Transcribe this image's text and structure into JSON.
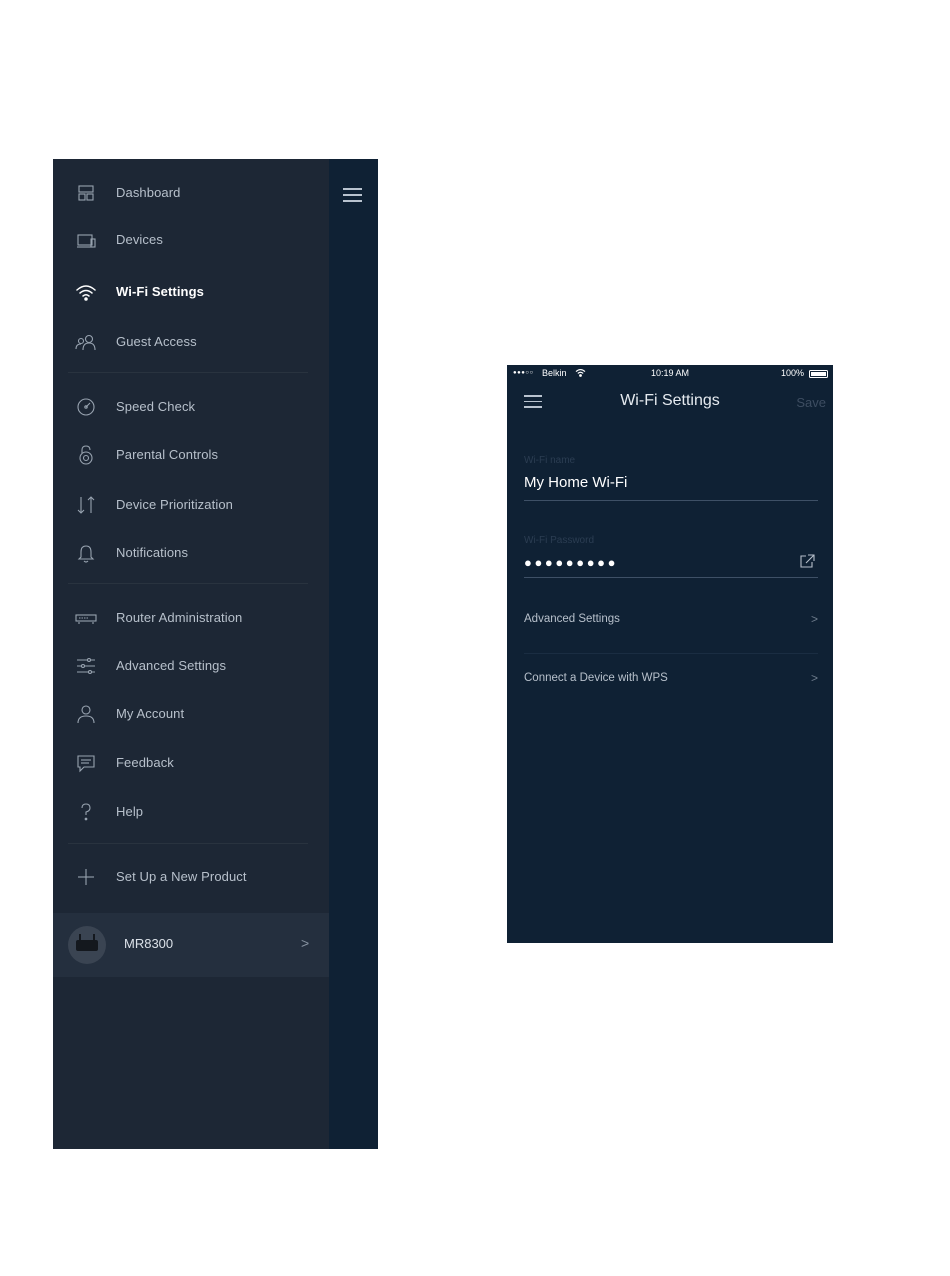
{
  "side_menu": {
    "items": [
      {
        "label": "Dashboard",
        "icon": "dashboard-icon",
        "active": false
      },
      {
        "label": "Devices",
        "icon": "devices-icon",
        "active": false
      },
      {
        "label": "Wi-Fi Settings",
        "icon": "wifi-icon",
        "active": true
      },
      {
        "label": "Guest Access",
        "icon": "guest-access-icon",
        "active": false
      },
      {
        "label": "Speed Check",
        "icon": "speedometer-icon",
        "active": false
      },
      {
        "label": "Parental Controls",
        "icon": "padlock-icon",
        "active": false
      },
      {
        "label": "Device Prioritization",
        "icon": "arrows-up-down-icon",
        "active": false
      },
      {
        "label": "Notifications",
        "icon": "bell-icon",
        "active": false
      },
      {
        "label": "Router Administration",
        "icon": "router-icon",
        "active": false
      },
      {
        "label": "Advanced Settings",
        "icon": "sliders-icon",
        "active": false
      },
      {
        "label": "My Account",
        "icon": "user-icon",
        "active": false
      },
      {
        "label": "Feedback",
        "icon": "chat-bubble-icon",
        "active": false
      },
      {
        "label": "Help",
        "icon": "question-icon",
        "active": false
      },
      {
        "label": "Set Up a New Product",
        "icon": "plus-icon",
        "active": false
      }
    ],
    "device": {
      "name": "MR8300",
      "chevron": ">"
    }
  },
  "wifi_screen": {
    "status_bar": {
      "signal": "●●●○○",
      "carrier": "Belkin",
      "time": "10:19 AM",
      "battery": "100%"
    },
    "title": "Wi-Fi Settings",
    "save_label": "Save",
    "wifi_name": {
      "label": "Wi-Fi name",
      "value": "My Home Wi-Fi"
    },
    "wifi_password": {
      "label": "Wi-Fi Password",
      "value": "●●●●●●●●●"
    },
    "rows": [
      {
        "label": "Advanced Settings",
        "chevron": ">"
      },
      {
        "label": "Connect a Device with WPS",
        "chevron": ">"
      }
    ]
  },
  "colors": {
    "menu_bg": "#1d2735",
    "screen_bg": "#0f2134",
    "menu_text": "#b7c0cb",
    "active_text": "#ffffff",
    "save_disabled": "#3d4d61"
  }
}
